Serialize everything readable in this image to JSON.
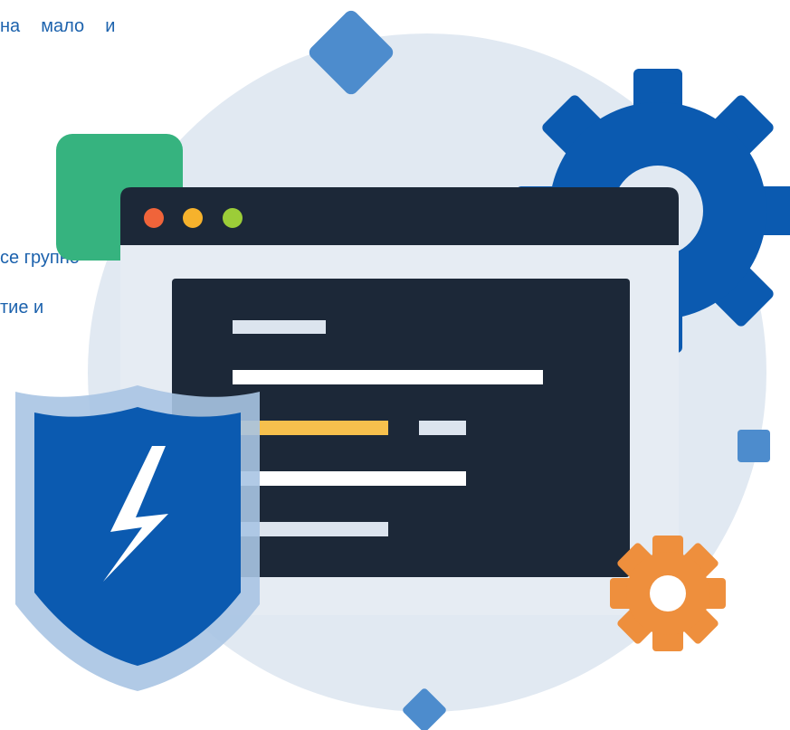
{
  "background_text": {
    "line1": "на  мало  и",
    "line2": "се групно",
    "line3": "тие и"
  },
  "colors": {
    "text": "#1c62ad",
    "bg_circle": "#e1e9f2",
    "window_frame": "#1c2838",
    "window_body": "#e6ecf3",
    "code_panel": "#1c2838",
    "dot_red": "#f0643a",
    "dot_yellow": "#f6b22c",
    "dot_green": "#9ccd38",
    "gear_large": "#0b5ab0",
    "gear_small": "#ee8f3d",
    "green_square": "#36b37f",
    "diamond": "#4d8ccd",
    "shield_outer": "#a9c4e3",
    "shield_inner": "#0b5ab0",
    "line_white": "#ffffff",
    "line_yellow": "#f6c04d",
    "line_light": "#dce4ee"
  },
  "icons": [
    "gear-icon",
    "shield-icon",
    "lightning-bolt-icon",
    "browser-window-icon",
    "code-lines-icon"
  ]
}
